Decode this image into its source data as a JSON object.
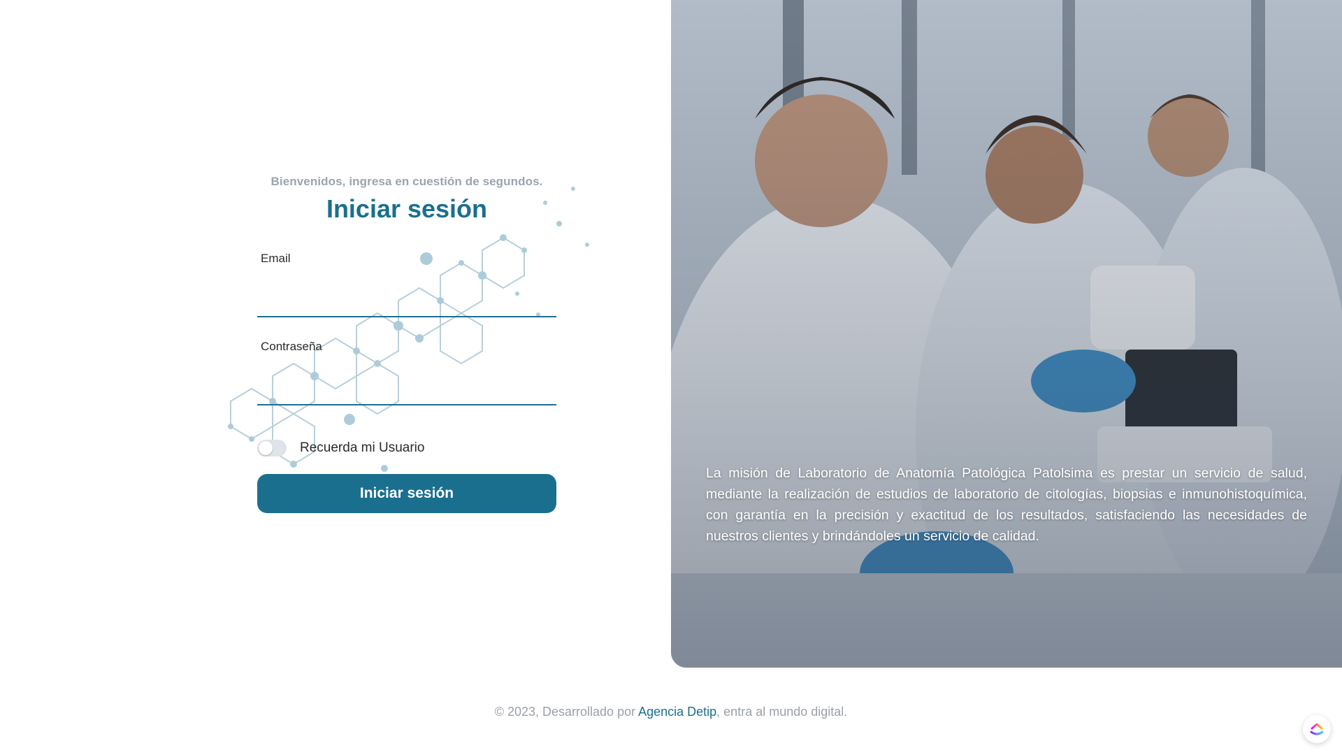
{
  "login": {
    "welcome": "Bienvenidos, ingresa en cuestión de segundos.",
    "title": "Iniciar sesión",
    "email": {
      "label": "Email",
      "value": "",
      "placeholder": ""
    },
    "password": {
      "label": "Contraseña",
      "value": "",
      "placeholder": ""
    },
    "remember": {
      "label": "Recuerda mi Usuario",
      "checked": false
    },
    "submit_label": "Iniciar sesión"
  },
  "hero": {
    "mission": "La misión de Laboratorio de Anatomía Patológica Patolsima es prestar un servicio de salud, mediante la realización de estudios de laboratorio de citologías, biopsias e inmunohistoquímica, con garantía en la precisión y exactitud de los resultados, satisfaciendo las necesidades de nuestros clientes y brindándoles un servicio de calidad.",
    "image": "lab-scientists-microscope-photo"
  },
  "footer": {
    "prefix": "© 2023, Desarrollado por ",
    "link_text": "Agencia Detip",
    "suffix": ", entra al mundo digital."
  },
  "widget": {
    "icon": "clickup-icon"
  },
  "colors": {
    "accent": "#1b6f8e",
    "muted": "#9aa4b2",
    "footer_text": "#9aa0a8"
  }
}
